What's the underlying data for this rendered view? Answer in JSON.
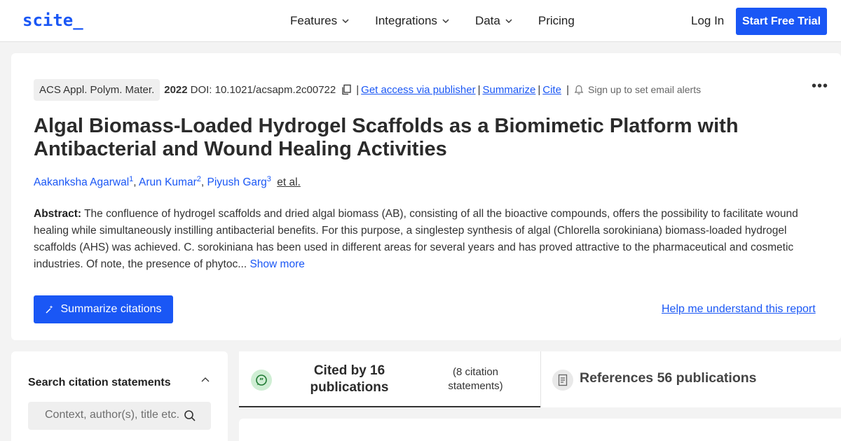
{
  "header": {
    "logo": "scite_",
    "nav": [
      {
        "label": "Features",
        "dropdown": true
      },
      {
        "label": "Integrations",
        "dropdown": true
      },
      {
        "label": "Data",
        "dropdown": true
      },
      {
        "label": "Pricing",
        "dropdown": false
      }
    ],
    "login_label": "Log In",
    "trial_label": "Start Free Trial"
  },
  "paper": {
    "journal": "ACS Appl. Polym. Mater.",
    "year": "2022",
    "doi": "DOI: 10.1021/acsapm.2c00722",
    "links": {
      "access": "Get access via publisher",
      "summarize": "Summarize",
      "cite": "Cite"
    },
    "alert_text": "Sign up to set email alerts",
    "title": "Algal Biomass-Loaded Hydrogel Scaffolds as a Biomimetic Platform with Antibacterial and Wound Healing Activities",
    "authors": [
      {
        "name": "Aakanksha Agarwal",
        "sup": "1"
      },
      {
        "name": "Arun Kumar",
        "sup": "2"
      },
      {
        "name": "Piyush Garg",
        "sup": "3"
      }
    ],
    "et_al": "et al.",
    "abstract_label": "Abstract:",
    "abstract_text": "The confluence of hydrogel scaffolds and dried algal biomass (AB), consisting of all the bioactive compounds, offers the possibility to facilitate wound healing while simultaneously instilling antibacterial benefits. For this purpose, a singlestep synthesis of algal (Chlorella sorokiniana) biomass-loaded hydrogel scaffolds (AHS) was achieved. C. sorokiniana has been used in different areas for several years and has proved attractive to the pharmaceutical and cosmetic industries. Of note, the presence of phytoc...",
    "show_more": "Show more",
    "summarize_citations": "Summarize citations",
    "help_link": "Help me understand this report"
  },
  "sidebar": {
    "title": "Search citation statements",
    "search_placeholder": "Context, author(s), title etc."
  },
  "tabs": {
    "cited_by": "Cited by 16 publications",
    "cited_statements": "(8 citation statements)",
    "references": "References 56 publications"
  },
  "colors": {
    "brand": "#1a57f5",
    "quote_badge": "#cfeed4"
  }
}
